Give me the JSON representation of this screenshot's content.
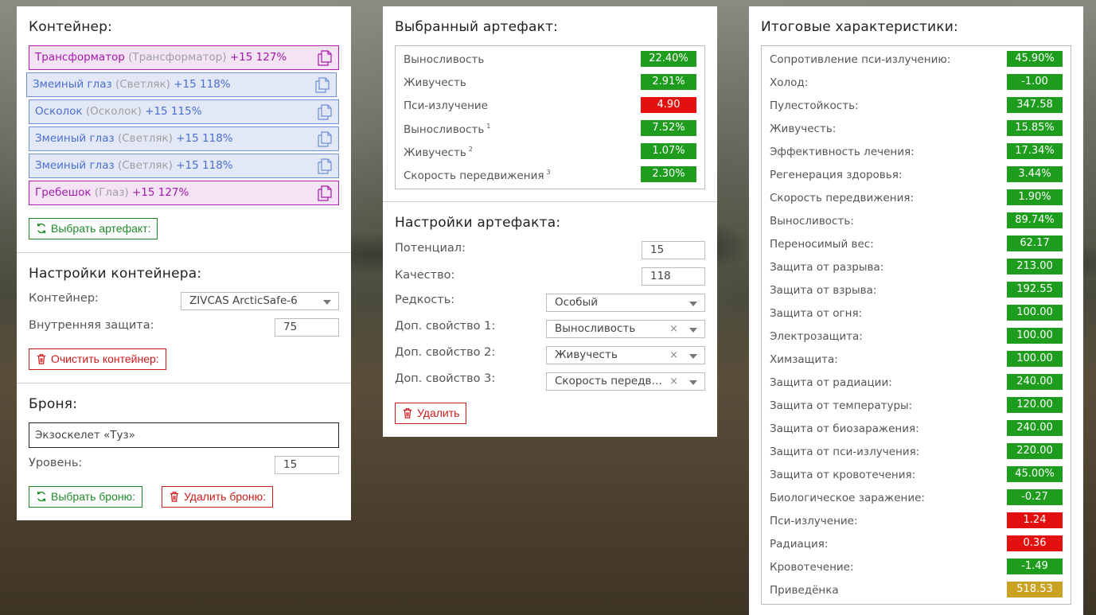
{
  "container_section": {
    "title": "Контейнер:",
    "artifacts": [
      {
        "name": "Трансформатор",
        "sub": "(Трансформатор)",
        "stats": "+15 127%",
        "style": "purple"
      },
      {
        "name": "Змеиный глаз",
        "sub": "(Светляк)",
        "stats": "+15 118%",
        "style": "blue"
      },
      {
        "name": "Осколок",
        "sub": "(Осколок)",
        "stats": "+15 115%",
        "style": "blue"
      },
      {
        "name": "Змеиный глаз",
        "sub": "(Светляк)",
        "stats": "+15 118%",
        "style": "blue"
      },
      {
        "name": "Змеиный глаз",
        "sub": "(Светляк)",
        "stats": "+15 118%",
        "style": "blue"
      },
      {
        "name": "Гребешок",
        "sub": "(Глаз)",
        "stats": "+15 127%",
        "style": "purple"
      }
    ],
    "select_button": "Выбрать артефакт:"
  },
  "container_settings": {
    "title": "Настройки контейнера:",
    "container_label": "Контейнер:",
    "container_value": "ZIVCAS ArcticSafe-6",
    "protection_label": "Внутренняя защита:",
    "protection_value": "75",
    "clear_button": "Очистить контейнер:"
  },
  "armor": {
    "title": "Броня:",
    "name_value": "Экзоскелет «Туз»",
    "level_label": "Уровень:",
    "level_value": "15",
    "select_button": "Выбрать броню:",
    "delete_button": "Удалить броню:"
  },
  "selected_artifact": {
    "title": "Выбранный артефакт:",
    "stats": [
      {
        "name": "Выносливость",
        "sup": "",
        "value": "22.40%",
        "color": "green"
      },
      {
        "name": "Живучесть",
        "sup": "",
        "value": "2.91%",
        "color": "green"
      },
      {
        "name": "Пси-излучение",
        "sup": "",
        "value": "4.90",
        "color": "red"
      },
      {
        "name": "Выносливость",
        "sup": "1",
        "value": "7.52%",
        "color": "green"
      },
      {
        "name": "Живучесть",
        "sup": "2",
        "value": "1.07%",
        "color": "green"
      },
      {
        "name": "Скорость передвижения",
        "sup": "3",
        "value": "2.30%",
        "color": "green"
      }
    ]
  },
  "artifact_settings": {
    "title": "Настройки артефакта:",
    "potential_label": "Потенциал:",
    "potential_value": "15",
    "quality_label": "Качество:",
    "quality_value": "118",
    "rarity_label": "Редкость:",
    "rarity_value": "Особый",
    "prop1_label": "Доп. свойство 1:",
    "prop1_value": "Выносливость",
    "prop2_label": "Доп. свойство 2:",
    "prop2_value": "Живучесть",
    "prop3_label": "Доп. свойство 3:",
    "prop3_value": "Скорость передвижения",
    "clear_symbol": "×",
    "delete_button": "Удалить"
  },
  "totals": {
    "title": "Итоговые характеристики:",
    "stats": [
      {
        "name": "Сопротивление пси-излучению:",
        "value": "45.90%",
        "color": "green"
      },
      {
        "name": "Холод:",
        "value": "-1.00",
        "color": "green"
      },
      {
        "name": "Пулестойкость:",
        "value": "347.58",
        "color": "green"
      },
      {
        "name": "Живучесть:",
        "value": "15.85%",
        "color": "green"
      },
      {
        "name": "Эффективность лечения:",
        "value": "17.34%",
        "color": "green"
      },
      {
        "name": "Регенерация здоровья:",
        "value": "3.44%",
        "color": "green"
      },
      {
        "name": "Скорость передвижения:",
        "value": "1.90%",
        "color": "green"
      },
      {
        "name": "Выносливость:",
        "value": "89.74%",
        "color": "green"
      },
      {
        "name": "Переносимый вес:",
        "value": "62.17",
        "color": "green"
      },
      {
        "name": "Защита от разрыва:",
        "value": "213.00",
        "color": "green"
      },
      {
        "name": "Защита от взрыва:",
        "value": "192.55",
        "color": "green"
      },
      {
        "name": "Защита от огня:",
        "value": "100.00",
        "color": "green"
      },
      {
        "name": "Электрозащита:",
        "value": "100.00",
        "color": "green"
      },
      {
        "name": "Химзащита:",
        "value": "100.00",
        "color": "green"
      },
      {
        "name": "Защита от радиации:",
        "value": "240.00",
        "color": "green"
      },
      {
        "name": "Защита от температуры:",
        "value": "120.00",
        "color": "green"
      },
      {
        "name": "Защита от биозаражения:",
        "value": "240.00",
        "color": "green"
      },
      {
        "name": "Защита от пси-излучения:",
        "value": "220.00",
        "color": "green"
      },
      {
        "name": "Защита от кровотечения:",
        "value": "45.00%",
        "color": "green"
      },
      {
        "name": "Биологическое заражение:",
        "value": "-0.27",
        "color": "green"
      },
      {
        "name": "Пси-излучение:",
        "value": "1.24",
        "color": "red"
      },
      {
        "name": "Радиация:",
        "value": "0.36",
        "color": "red"
      },
      {
        "name": "Кровотечение:",
        "value": "-1.49",
        "color": "green"
      },
      {
        "name": "Приведёнка",
        "value": "518.53",
        "color": "gold"
      }
    ]
  },
  "colors": {
    "green": "#1e9c1e",
    "red": "#e31010",
    "gold": "#c9a224",
    "purple": "#a21aa8",
    "blue": "#4a6fcf"
  }
}
